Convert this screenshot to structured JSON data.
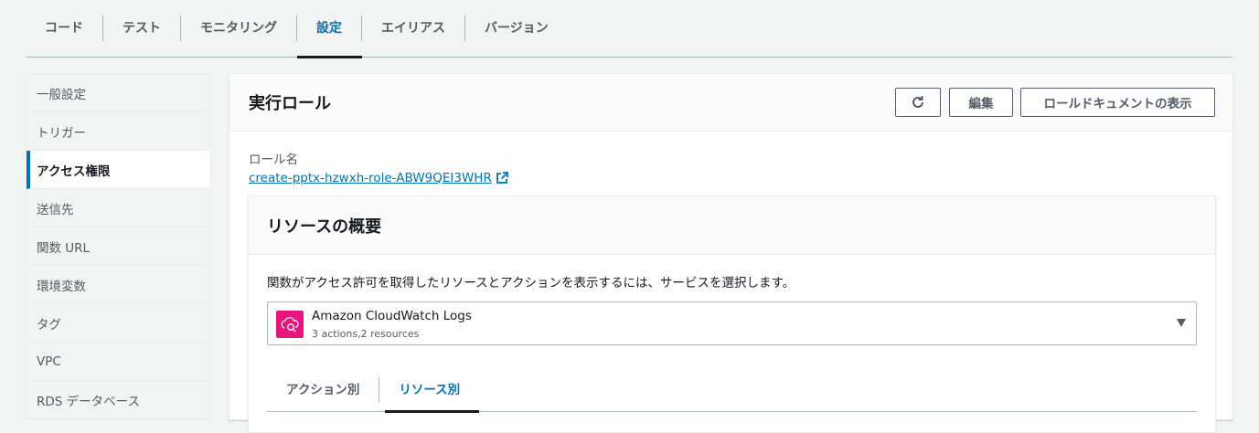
{
  "top_tabs": [
    {
      "label": "コード",
      "active": false
    },
    {
      "label": "テスト",
      "active": false
    },
    {
      "label": "モニタリング",
      "active": false
    },
    {
      "label": "設定",
      "active": true
    },
    {
      "label": "エイリアス",
      "active": false
    },
    {
      "label": "バージョン",
      "active": false
    }
  ],
  "sidebar": {
    "items": [
      {
        "label": "一般設定",
        "active": false
      },
      {
        "label": "トリガー",
        "active": false
      },
      {
        "label": "アクセス権限",
        "active": true
      },
      {
        "label": "送信先",
        "active": false
      },
      {
        "label": "関数 URL",
        "active": false
      },
      {
        "label": "環境変数",
        "active": false
      },
      {
        "label": "タグ",
        "active": false
      },
      {
        "label": "VPC",
        "active": false
      },
      {
        "label": "RDS データベース",
        "active": false
      }
    ]
  },
  "execution_role": {
    "title": "実行ロール",
    "refresh_icon": "refresh-icon",
    "edit_label": "編集",
    "view_doc_label": "ロールドキュメントの表示",
    "role_name_label": "ロール名",
    "role_name": "create-pptx-hzwxh-role-ABW9QEI3WHR",
    "external_link_icon": "external-link-icon"
  },
  "resource_summary": {
    "title": "リソースの概要",
    "description": "関数がアクセス許可を取得したリソースとアクションを表示するには、サービスを選択します。",
    "selected_service": {
      "name": "Amazon CloudWatch Logs",
      "detail": "3 actions,2 resources",
      "icon": "cloudwatch-logs-icon"
    },
    "tabs": [
      {
        "label": "アクション別",
        "active": false
      },
      {
        "label": "リソース別",
        "active": true
      }
    ]
  },
  "colors": {
    "accent": "#0073bb",
    "service_icon_bg": "#e7157b",
    "text": "#16191f",
    "muted": "#545b64"
  }
}
